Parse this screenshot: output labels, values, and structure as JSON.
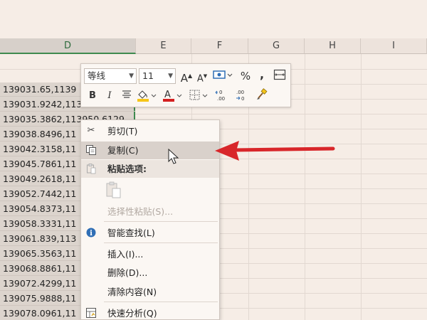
{
  "columns": [
    "D",
    "E",
    "F",
    "G",
    "H",
    "I"
  ],
  "selected_column": "D",
  "cells": [
    "139031.65,1139",
    "139031.9242,113",
    "139035.3862,113950.6129",
    "139038.8496,11",
    "139042.3158,11",
    "139045.7861,11",
    "139049.2618,11",
    "139052.7442,11",
    "139054.8373,11",
    "139058.3331,11",
    "139061.839,113",
    "139065.3563,11",
    "139068.8861,11",
    "139072.4299,11",
    "139075.9888,11",
    "139078.0961,11"
  ],
  "mini_toolbar": {
    "font_name": "等线",
    "font_size": "11",
    "percent": "%",
    "comma": ",",
    "bold": "B",
    "italic": "I",
    "grow_font": "A",
    "shrink_font": "A",
    "font_color_letter": "A",
    "fill_color": "#f5c518",
    "font_color": "#d42020"
  },
  "context_menu": {
    "cut": "剪切(T)",
    "copy": "复制(C)",
    "paste_options": "粘贴选项:",
    "paste_special": "选择性粘贴(S)...",
    "smart_lookup": "智能查找(L)",
    "insert": "插入(I)...",
    "delete": "删除(D)...",
    "clear_contents": "清除内容(N)",
    "quick_analysis": "快速分析(Q)"
  },
  "colors": {
    "selection_green": "#3f8a4f",
    "annotation_red": "#d8262a"
  }
}
